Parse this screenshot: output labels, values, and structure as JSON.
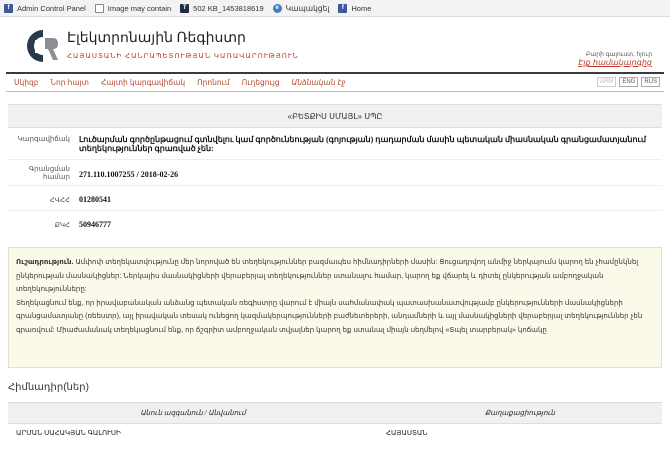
{
  "bookmarks": [
    {
      "icon": "facebook-icon",
      "label": "Admin Control Panel"
    },
    {
      "icon": "document-icon",
      "label": "Image may contain"
    },
    {
      "icon": "t-icon",
      "label": "502 KB_1453818619"
    },
    {
      "icon": "edge-icon",
      "label": "Կապակցել"
    },
    {
      "icon": "facebook-icon",
      "label": "Home"
    }
  ],
  "header": {
    "title": "Էլեկտրոնային Ռեգիստր",
    "subtitle": "ՀԱՅԱՍՏԱՆԻ ՀԱՆՐԱՊԵՏՈՒԹՅԱՆ ԿԱՌԱՎԱՐՈՒԹՅՈՒՆ",
    "welcome": "Բարի գալուստ, հյուր",
    "login": "Էլք համակարգից"
  },
  "nav": {
    "items": [
      "Սկիզբ",
      "Նոր հայտ",
      "Հայտի կարգավիճակ",
      "Որոնում",
      "Ուղեցույց",
      "Անձնական էջ"
    ],
    "active_index": 5,
    "langs": [
      "ARM",
      "ENG",
      "RUS"
    ]
  },
  "company": {
    "name": "«ԲԵՏՔԻՍ ՍՄԱՅԼ» ՍՊԸ",
    "status_label": "Կարգավիճակ",
    "status_value": "Լուծարման գործընթացում գտնվելու կամ գործունեության (գոյության) դադարման մասին պետական միասնական գրանցամատյանում տեղեկություններ գրառված չեն:",
    "regnum_label": "Գրանցման համար",
    "regnum_value": "271.110.1007255 / 2018-02-26",
    "hvhh_label": "ՀՎՀՀ",
    "hvhh_value": "01280541",
    "tin_label": "ՔԿՀ",
    "tin_value": "50946777"
  },
  "notice": {
    "bold": "Ուշադրություն.",
    "text1": " Ամփոփ տեղեկատվությունը մեր նորոված են տեղեկություններ բազմապես հիմնադիրների մասին: Ցուցադրվող անմիջ ներկայումս կարող են չհամընկնել ընկերության մասնակիցներ: Ներկայիս մասնակիցների վերաբերյալ տեղեկություններ ստանալու համար, կարող եք վճարել և դիտել ընկերության ամբողջական տեղեկությունները:",
    "text2": "Տեղեկացնում ենք, որ իրավաբանական անձանց պետական ռեգիստրը վարում է միայն սահմանափակ պատասխանատվությամբ ընկերությունների մասնակիցների գրանցամատյանը (ռեեստր), այլ իրավական տեսակ ունեցող կազմակերպությունների բաժնետերերի, անդամների և այլ մասնակիցների վերաբերյալ տեղեկություններ չեն գրառվում: Միաժամանակ տեղեկացնում ենք, որ ճշգրիտ ամբողջական տվյալներ կարող եք ստանալ միայն սեղմելով «Տպել տարբերակ» կոճակը"
  },
  "founders": {
    "title": "Հիմնադիր(ներ)",
    "col1": "Անուն ազգանուն / Անվանում",
    "col2": "Քաղաքացիություն",
    "rows": [
      {
        "name": "ԱՐՄԱՆ ՍԱՀԱԿՅԱՆ ԳԱԼՈՒՍԻ",
        "citizenship": "ՀԱՅԱՍՏԱՆ"
      }
    ]
  }
}
